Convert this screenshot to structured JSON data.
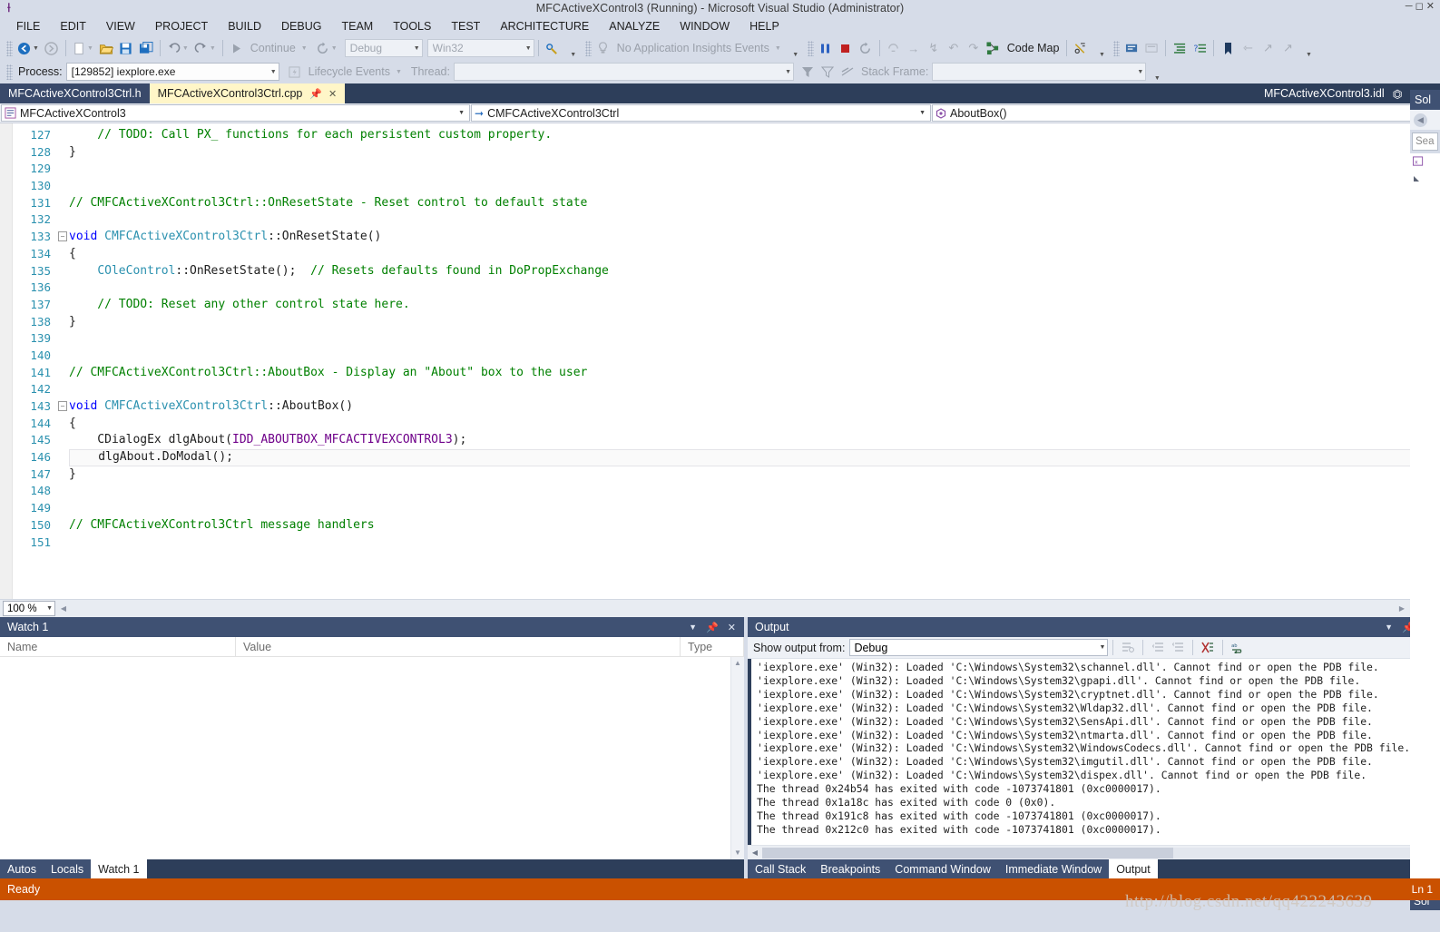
{
  "window": {
    "title": "MFCActiveXControl3 (Running) - Microsoft Visual Studio (Administrator)",
    "logo_icon": "visual-studio-logo"
  },
  "menu": {
    "items": [
      "FILE",
      "EDIT",
      "VIEW",
      "PROJECT",
      "BUILD",
      "DEBUG",
      "TEAM",
      "TOOLS",
      "TEST",
      "ARCHITECTURE",
      "ANALYZE",
      "WINDOW",
      "HELP"
    ]
  },
  "toolbar": {
    "navigate_back": "◀",
    "navigate_forward": "▶",
    "new_item_label": "new-item",
    "open_label": "open-file",
    "save_label": "save",
    "save_all_label": "save-all",
    "undo_label": "undo",
    "redo_label": "redo",
    "continue_label": "Continue",
    "restart_label": "restart",
    "config": "Debug",
    "platform": "Win32",
    "insights_label": "No Application Insights Events",
    "break_all_label": "break-all",
    "stop_label": "stop-debugging",
    "restart_debug_label": "restart-debugging",
    "show_next_statement_label": "show-next-statement",
    "step_into_label": "step-into",
    "step_over_label": "step-over",
    "step_out_label": "step-out",
    "code_map_label": "Code Map"
  },
  "debug_toolbar": {
    "process_label": "Process:",
    "process_value": "[129852] iexplore.exe",
    "lifecycle_label": "Lifecycle Events",
    "thread_label": "Thread:",
    "thread_value": "",
    "stack_frame_label": "Stack Frame:",
    "stack_frame_value": ""
  },
  "tabs": {
    "items": [
      {
        "label": "MFCActiveXControl3Ctrl.h",
        "active": false
      },
      {
        "label": "MFCActiveXControl3Ctrl.cpp",
        "active": true
      }
    ],
    "right_file": "MFCActiveXControl3.idl",
    "pin_icon": "pin-icon",
    "close_icon": "close-icon",
    "dropdown_icon": "chevron-down-icon"
  },
  "navbar": {
    "project": "MFCActiveXControl3",
    "class": "CMFCActiveXControl3Ctrl",
    "member": "AboutBox()"
  },
  "editor": {
    "first_line": 127,
    "current_line": 146,
    "zoom": "100 %",
    "lines": [
      {
        "n": 127,
        "fold": "",
        "tokens": [
          {
            "t": "    // TODO: Call PX_ functions for each persistent custom property.",
            "c": "c-cm"
          }
        ]
      },
      {
        "n": 128,
        "fold": "",
        "tokens": [
          {
            "t": "}",
            "c": "c-pl"
          }
        ]
      },
      {
        "n": 129,
        "fold": "",
        "tokens": []
      },
      {
        "n": 130,
        "fold": "",
        "tokens": []
      },
      {
        "n": 131,
        "fold": "",
        "tokens": [
          {
            "t": "// CMFCActiveXControl3Ctrl::OnResetState - Reset control to default state",
            "c": "c-cm"
          }
        ]
      },
      {
        "n": 132,
        "fold": "",
        "tokens": []
      },
      {
        "n": 133,
        "fold": "-",
        "tokens": [
          {
            "t": "void ",
            "c": "c-kw"
          },
          {
            "t": "CMFCActiveXControl3Ctrl",
            "c": "c-ty"
          },
          {
            "t": "::OnResetState()",
            "c": "c-pl"
          }
        ]
      },
      {
        "n": 134,
        "fold": "",
        "tokens": [
          {
            "t": "{",
            "c": "c-pl"
          }
        ]
      },
      {
        "n": 135,
        "fold": "",
        "tokens": [
          {
            "t": "    ",
            "c": "c-pl"
          },
          {
            "t": "COleControl",
            "c": "c-ty"
          },
          {
            "t": "::OnResetState();  ",
            "c": "c-pl"
          },
          {
            "t": "// Resets defaults found in DoPropExchange",
            "c": "c-cm"
          }
        ]
      },
      {
        "n": 136,
        "fold": "",
        "tokens": []
      },
      {
        "n": 137,
        "fold": "",
        "tokens": [
          {
            "t": "    // TODO: Reset any other control state here.",
            "c": "c-cm"
          }
        ]
      },
      {
        "n": 138,
        "fold": "",
        "tokens": [
          {
            "t": "}",
            "c": "c-pl"
          }
        ]
      },
      {
        "n": 139,
        "fold": "",
        "tokens": []
      },
      {
        "n": 140,
        "fold": "",
        "tokens": []
      },
      {
        "n": 141,
        "fold": "",
        "tokens": [
          {
            "t": "// CMFCActiveXControl3Ctrl::AboutBox - Display an \"About\" box to the user",
            "c": "c-cm"
          }
        ]
      },
      {
        "n": 142,
        "fold": "",
        "tokens": []
      },
      {
        "n": 143,
        "fold": "-",
        "tokens": [
          {
            "t": "void ",
            "c": "c-kw"
          },
          {
            "t": "CMFCActiveXControl3Ctrl",
            "c": "c-ty"
          },
          {
            "t": "::AboutBox()",
            "c": "c-pl"
          }
        ]
      },
      {
        "n": 144,
        "fold": "",
        "tokens": [
          {
            "t": "{",
            "c": "c-pl"
          }
        ]
      },
      {
        "n": 145,
        "fold": "",
        "tokens": [
          {
            "t": "    CDialogEx dlgAbout(",
            "c": "c-pl"
          },
          {
            "t": "IDD_ABOUTBOX_MFCACTIVEXCONTROL3",
            "c": "c-mac"
          },
          {
            "t": ");",
            "c": "c-pl"
          }
        ]
      },
      {
        "n": 146,
        "fold": "",
        "current": true,
        "tokens": [
          {
            "t": "    dlgAbout.DoModal();",
            "c": "c-pl"
          }
        ]
      },
      {
        "n": 147,
        "fold": "",
        "tokens": [
          {
            "t": "}",
            "c": "c-pl"
          }
        ]
      },
      {
        "n": 148,
        "fold": "",
        "tokens": []
      },
      {
        "n": 149,
        "fold": "",
        "tokens": []
      },
      {
        "n": 150,
        "fold": "",
        "tokens": [
          {
            "t": "// CMFCActiveXControl3Ctrl message handlers",
            "c": "c-cm"
          }
        ]
      },
      {
        "n": 151,
        "fold": "",
        "tokens": []
      }
    ]
  },
  "watch_panel": {
    "title": "Watch 1",
    "columns": [
      "Name",
      "Value",
      "Type"
    ],
    "rows": [],
    "tabs": [
      {
        "label": "Autos",
        "selected": false
      },
      {
        "label": "Locals",
        "selected": false
      },
      {
        "label": "Watch 1",
        "selected": true
      }
    ]
  },
  "output_panel": {
    "title": "Output",
    "show_output_from_label": "Show output from:",
    "source": "Debug",
    "lines": [
      "'iexplore.exe' (Win32): Loaded 'C:\\Windows\\System32\\schannel.dll'. Cannot find or open the PDB file.",
      "'iexplore.exe' (Win32): Loaded 'C:\\Windows\\System32\\gpapi.dll'. Cannot find or open the PDB file.",
      "'iexplore.exe' (Win32): Loaded 'C:\\Windows\\System32\\cryptnet.dll'. Cannot find or open the PDB file.",
      "'iexplore.exe' (Win32): Loaded 'C:\\Windows\\System32\\Wldap32.dll'. Cannot find or open the PDB file.",
      "'iexplore.exe' (Win32): Loaded 'C:\\Windows\\System32\\SensApi.dll'. Cannot find or open the PDB file.",
      "'iexplore.exe' (Win32): Loaded 'C:\\Windows\\System32\\ntmarta.dll'. Cannot find or open the PDB file.",
      "'iexplore.exe' (Win32): Loaded 'C:\\Windows\\System32\\WindowsCodecs.dll'. Cannot find or open the PDB file.",
      "'iexplore.exe' (Win32): Loaded 'C:\\Windows\\System32\\imgutil.dll'. Cannot find or open the PDB file.",
      "'iexplore.exe' (Win32): Loaded 'C:\\Windows\\System32\\dispex.dll'. Cannot find or open the PDB file.",
      "The thread 0x24b54 has exited with code -1073741801 (0xc0000017).",
      "The thread 0x1a18c has exited with code 0 (0x0).",
      "The thread 0x191c8 has exited with code -1073741801 (0xc0000017).",
      "The thread 0x212c0 has exited with code -1073741801 (0xc0000017)."
    ],
    "tabs": [
      {
        "label": "Call Stack",
        "selected": false
      },
      {
        "label": "Breakpoints",
        "selected": false
      },
      {
        "label": "Command Window",
        "selected": false
      },
      {
        "label": "Immediate Window",
        "selected": false
      },
      {
        "label": "Output",
        "selected": true
      }
    ]
  },
  "solution_explorer": {
    "title": "Sol",
    "search_placeholder": "Sea",
    "footer_tab": "Sol"
  },
  "statusbar": {
    "text": "Ready",
    "position": "Ln 1"
  },
  "watermark": {
    "text": "http://blog.csdn.net/qq422243639"
  },
  "colors": {
    "chrome": "#d6dce8",
    "tabstrip": "#2d3e5a",
    "panel_header": "#3f5173",
    "active_tab": "#fff6c8",
    "status_debug": "#ca5100",
    "comment": "#008000",
    "keyword": "#0000ff",
    "type": "#2b91af",
    "macro": "#6f008a"
  }
}
